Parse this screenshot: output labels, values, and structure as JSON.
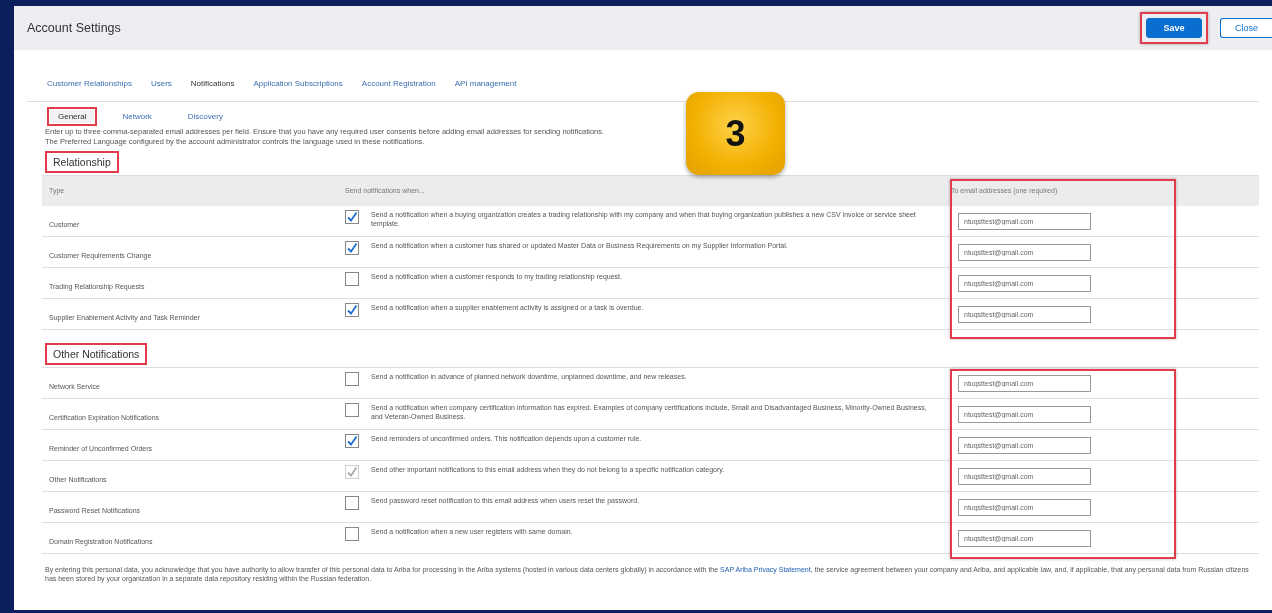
{
  "window": {
    "title": "Account Settings"
  },
  "buttons": [
    {
      "label": "Save",
      "kind": "primary",
      "highlighted": true
    },
    {
      "label": "Close",
      "kind": "secondary",
      "highlighted": false
    }
  ],
  "tabs": [
    {
      "label": "Customer Relationships",
      "selected": false
    },
    {
      "label": "Users",
      "selected": false
    },
    {
      "label": "Notifications",
      "selected": true
    },
    {
      "label": "Application Subscriptions",
      "selected": false
    },
    {
      "label": "Account Registration",
      "selected": false
    },
    {
      "label": "API management",
      "selected": false
    }
  ],
  "subtabs": [
    {
      "label": "General",
      "selected": true,
      "highlighted": true
    },
    {
      "label": "Network",
      "selected": false,
      "highlighted": false
    },
    {
      "label": "Discovery",
      "selected": false,
      "highlighted": false
    }
  ],
  "callout": {
    "number": "3"
  },
  "instructions": [
    "Enter up to three comma-separated email addresses per field. Ensure that you have any required user consents before adding email addresses for sending notifications.",
    "The Preferred Language configured by the account administrator controls the language used in these notifications."
  ],
  "sections": [
    {
      "title": "Relationship",
      "highlighted": true,
      "email_highlighted": true,
      "columns": [
        "Type",
        "Send notifications when...",
        "To email addresses (one required)"
      ],
      "rows": [
        {
          "type": "Customer",
          "checked": true,
          "disabled": false,
          "description": "Send a notification when a buying organization creates a trading relationship with my company and when that buying organization publishes a new CSV invoice or service sheet template.",
          "email": "ntugsttest@gmail.com"
        },
        {
          "type": "Customer Requirements Change",
          "checked": true,
          "disabled": false,
          "description": "Send a notification when a customer has shared or updated Master Data or Business Requirements on my Supplier Information Portal.",
          "email": "ntugsttest@gmail.com"
        },
        {
          "type": "Trading Relationship Requests",
          "checked": false,
          "disabled": false,
          "description": "Send a notification when a customer responds to my trading relationship request.",
          "email": "ntugsttest@gmail.com"
        },
        {
          "type": "Supplier Enablement Activity and Task Reminder",
          "checked": true,
          "disabled": false,
          "description": "Send a notification when a supplier enablement activity is assigned or a task is overdue.",
          "email": "ntugsttest@gmail.com"
        }
      ]
    },
    {
      "title": "Other Notifications",
      "highlighted": true,
      "email_highlighted": true,
      "rows": [
        {
          "type": "Network Service",
          "checked": false,
          "disabled": false,
          "description": "Send a notification in advance of planned network downtime, unplanned downtime, and new releases.",
          "email": "ntugsttest@gmail.com"
        },
        {
          "type": "Certification Expiration Notifications",
          "checked": false,
          "disabled": false,
          "description": "Send a notification when company certification information has expired. Examples of company certifications include, Small and Disadvantaged Business, Minority-Owned Business, and Veteran-Owned Business.",
          "email": "ntugsttest@gmail.com"
        },
        {
          "type": "Reminder of Unconfirmed Orders",
          "checked": true,
          "disabled": false,
          "description": "Send reminders of unconfirmed orders. This notification depends upon a customer rule.",
          "email": "ntugsttest@gmail.com"
        },
        {
          "type": "Other Notifications",
          "checked": true,
          "disabled": true,
          "description": "Send other important notifications to this email address when they do not belong to a specific notification category.",
          "email": "ntugsttest@gmail.com"
        },
        {
          "type": "Password Reset Notifications",
          "checked": false,
          "disabled": false,
          "description": "Send password reset notification to this email address when users reset the password.",
          "email": "ntugsttest@gmail.com"
        },
        {
          "type": "Domain Registration Notifications",
          "checked": false,
          "disabled": false,
          "description": "Send a notification when a new user registers with same domain.",
          "email": "ntugsttest@gmail.com"
        }
      ]
    }
  ],
  "footer": {
    "text": "By entering this personal data, you acknowledge that you have authority to allow transfer of this personal data to Ariba for processing in the Ariba systems (hosted in various data centers globally) in accordance with the **SAP Ariba Privacy Statement**, the service agreement between your company and Ariba, and applicable law, and, if applicable, that any personal data from Russian citizens has been stored by your organization in a separate data repository residing within the Russian federation."
  }
}
